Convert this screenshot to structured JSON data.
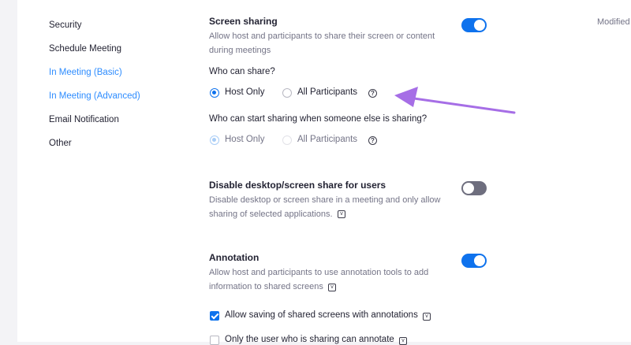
{
  "sidebar": {
    "items": [
      {
        "label": "Security",
        "active": false
      },
      {
        "label": "Schedule Meeting",
        "active": false
      },
      {
        "label": "In Meeting (Basic)",
        "active": true
      },
      {
        "label": "In Meeting (Advanced)",
        "active": true
      },
      {
        "label": "Email Notification",
        "active": false
      },
      {
        "label": "Other",
        "active": false
      }
    ]
  },
  "modified_label": "Modified",
  "screen_sharing": {
    "title": "Screen sharing",
    "description": "Allow host and participants to share their screen or content during meetings",
    "enabled": true,
    "who_can_share": {
      "question": "Who can share?",
      "options": [
        "Host Only",
        "All Participants"
      ],
      "selected": "Host Only"
    },
    "who_can_start": {
      "question": "Who can start sharing when someone else is sharing?",
      "options": [
        "Host Only",
        "All Participants"
      ],
      "selected": "Host Only",
      "disabled": true
    }
  },
  "disable_desktop_share": {
    "title": "Disable desktop/screen share for users",
    "description": "Disable desktop or screen share in a meeting and only allow sharing of selected applications.",
    "enabled": false
  },
  "annotation": {
    "title": "Annotation",
    "description": "Allow host and participants to use annotation tools to add information to shared screens",
    "enabled": true,
    "options": [
      {
        "label": "Allow saving of shared screens with annotations",
        "checked": true
      },
      {
        "label": "Only the user who is sharing can annotate",
        "checked": false
      }
    ]
  },
  "colors": {
    "accent": "#0e72ed",
    "link": "#2d8cff",
    "annotation_arrow": "#a66ee6"
  },
  "icons": {
    "help": "question-circle-icon",
    "info": "info-box-icon",
    "arrow": "pointer-arrow-icon"
  }
}
